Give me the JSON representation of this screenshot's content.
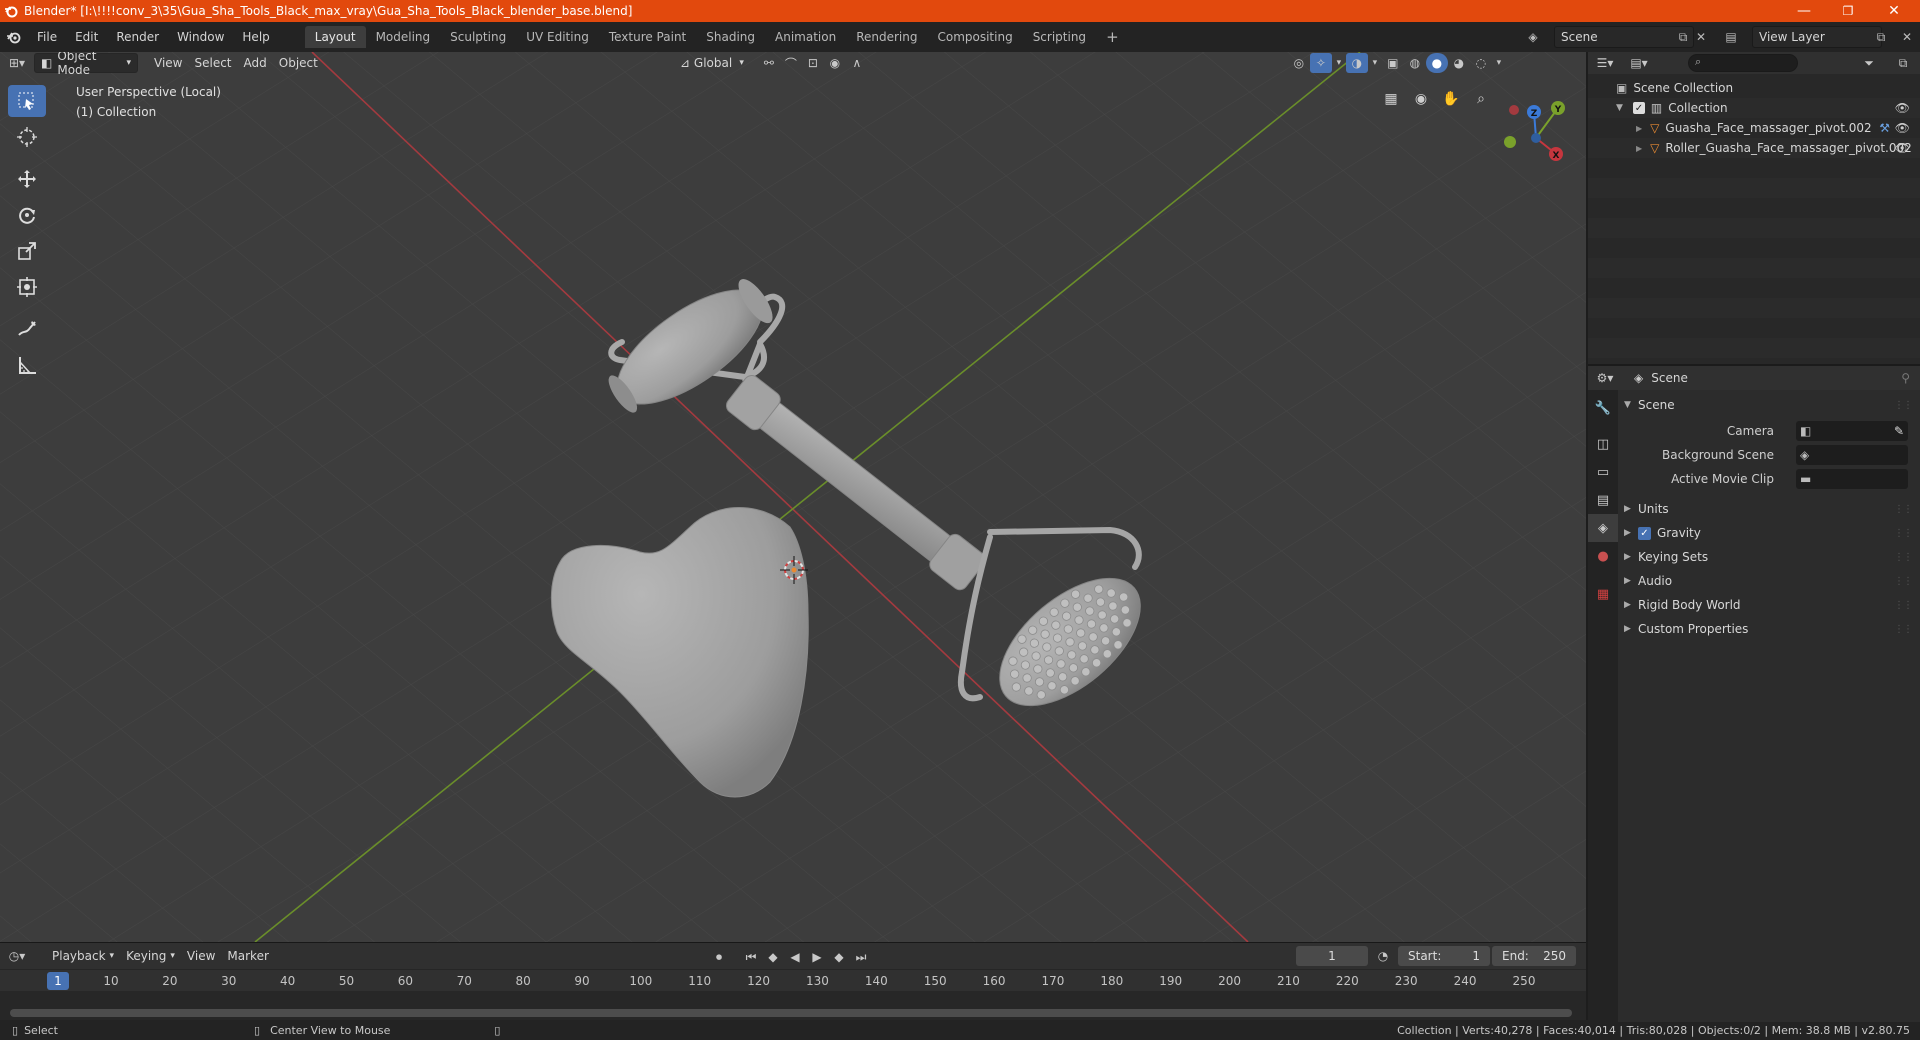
{
  "window": {
    "title": "Blender* [I:\\!!!!conv_3\\35\\Gua_Sha_Tools_Black_max_vray\\Gua_Sha_Tools_Black_blender_base.blend]",
    "minimize": "—",
    "restore": "❐",
    "close": "✕"
  },
  "menu": {
    "items": [
      "File",
      "Edit",
      "Render",
      "Window",
      "Help"
    ]
  },
  "workspaces": [
    "Layout",
    "Modeling",
    "Sculpting",
    "UV Editing",
    "Texture Paint",
    "Shading",
    "Animation",
    "Rendering",
    "Compositing",
    "Scripting"
  ],
  "workspace_add": "+",
  "scene_selector": "Scene",
  "view_layer_selector": "View Layer",
  "viewport": {
    "mode": "Object Mode",
    "menus": [
      "View",
      "Select",
      "Add",
      "Object"
    ],
    "transform_orientation": "Global",
    "perspective_label": "User Perspective (Local)",
    "collection_label": "(1) Collection",
    "gizmo": {
      "x": "X",
      "y": "Y",
      "z": "Z"
    }
  },
  "timeline": {
    "menus": [
      "Playback",
      "Keying",
      "View",
      "Marker"
    ],
    "current_frame": "1",
    "start_label": "Start:",
    "start_value": "1",
    "end_label": "End:",
    "end_value": "250",
    "ticks": [
      "1",
      "10",
      "20",
      "30",
      "40",
      "50",
      "60",
      "70",
      "80",
      "90",
      "100",
      "110",
      "120",
      "130",
      "140",
      "150",
      "160",
      "170",
      "180",
      "190",
      "200",
      "210",
      "220",
      "230",
      "240",
      "250"
    ]
  },
  "status": {
    "select": "Select",
    "center_view": "Center View to Mouse",
    "stats": "Collection | Verts:40,278 | Faces:40,014 | Tris:80,028 | Objects:0/2 | Mem: 38.8 MB | v2.80.75"
  },
  "outliner": {
    "scene_collection": "Scene Collection",
    "collection": "Collection",
    "objects": [
      "Guasha_Face_massager_pivot.002",
      "Roller_Guasha_Face_massager_pivot.002"
    ]
  },
  "properties": {
    "context": "Scene",
    "panel_scene": "Scene",
    "camera_label": "Camera",
    "background_scene_label": "Background Scene",
    "active_movie_clip_label": "Active Movie Clip",
    "panels": [
      "Units",
      "Gravity",
      "Keying Sets",
      "Audio",
      "Rigid Body World",
      "Custom Properties"
    ]
  },
  "colors": {
    "titlebar": "#e2490d",
    "accent": "#4772b3",
    "x_axis": "#c6363e",
    "y_axis": "#7aa12b",
    "z_axis": "#3b7ad8",
    "object_orange": "#e88a32"
  }
}
